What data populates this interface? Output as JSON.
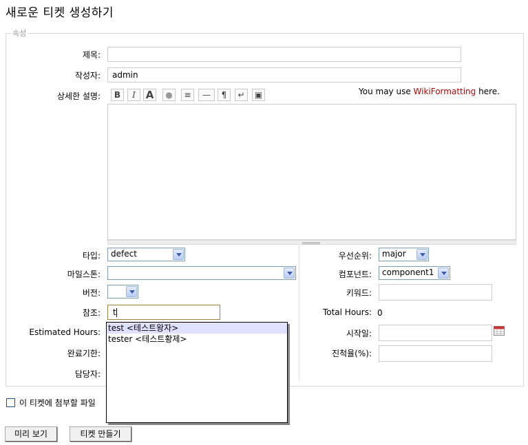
{
  "page": {
    "title": "새로운 티켓 생성하기"
  },
  "properties": {
    "legend": "속성"
  },
  "fields": {
    "summary": {
      "label": "제목:",
      "value": ""
    },
    "reporter": {
      "label": "작성자:",
      "value": "admin"
    },
    "description": {
      "label": "상세한 설명:",
      "value": ""
    },
    "type": {
      "label": "타입:",
      "value": "defect"
    },
    "milestone": {
      "label": "마일스톤:",
      "value": ""
    },
    "version": {
      "label": "버전:",
      "value": ""
    },
    "cc": {
      "label": "참조:",
      "value": "t"
    },
    "estimated_hours": {
      "label": "Estimated Hours:"
    },
    "due_date": {
      "label": "완료기한:"
    },
    "owner": {
      "label": "담당자:"
    },
    "priority": {
      "label": "우선순위:",
      "value": "major"
    },
    "component": {
      "label": "컴포넌트:",
      "value": "component1"
    },
    "keywords": {
      "label": "키워드:",
      "value": ""
    },
    "total_hours": {
      "label": "Total Hours:",
      "value": "0"
    },
    "start_date": {
      "label": "시작일:",
      "value": ""
    },
    "progress": {
      "label": "진척율(%):",
      "value": ""
    }
  },
  "toolbar": {
    "bold": "B",
    "italic": "I",
    "heading": "A",
    "link": "●",
    "code": "≡",
    "hr": "—",
    "paragraph": "¶",
    "linebreak": "↵",
    "image": "▣"
  },
  "wiki_hint": {
    "prefix": "You may use ",
    "link": "WikiFormatting",
    "suffix": " here."
  },
  "autocomplete": [
    "test <테스트왕자>",
    "tester <테스트황제>"
  ],
  "attach": {
    "label": "이 티켓에 첨부할 파일"
  },
  "buttons": {
    "preview": "미리 보기",
    "create": "티켓 만들기"
  }
}
